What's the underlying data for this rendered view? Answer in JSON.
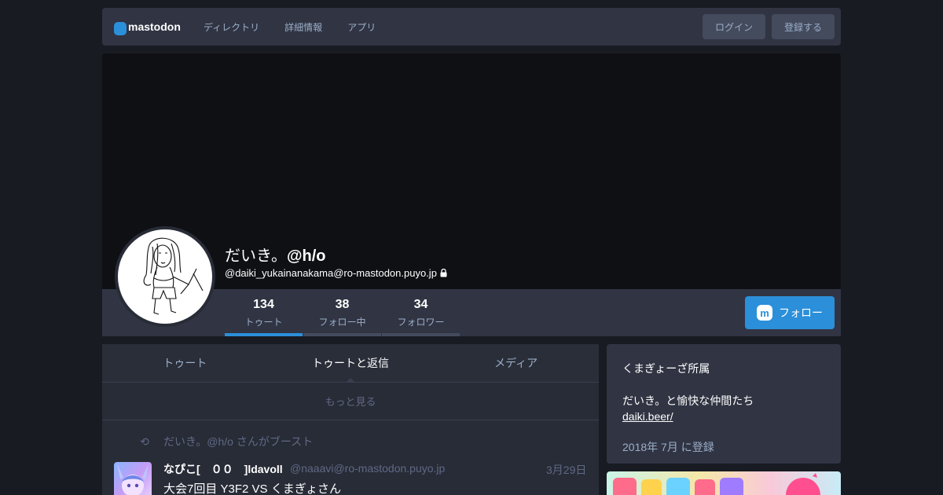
{
  "nav": {
    "logo_text": "mastodon",
    "links": [
      "ディレクトリ",
      "詳細情報",
      "アプリ"
    ],
    "login_label": "ログイン",
    "register_label": "登録する"
  },
  "profile": {
    "display_name": "だいき。",
    "display_name_suffix": "@h/o",
    "acct": "@daiki_yukainanakama@ro-mastodon.puyo.jp",
    "locked": true,
    "counters": [
      {
        "num": "134",
        "label": "トゥート"
      },
      {
        "num": "38",
        "label": "フォロー中"
      },
      {
        "num": "34",
        "label": "フォロワー"
      }
    ],
    "follow_label": "フォロー"
  },
  "tabs": [
    "トゥート",
    "トゥートと返信",
    "メディア"
  ],
  "active_tab": 1,
  "more_label": "もっと見る",
  "status": {
    "boost_text": "だいき。@h/o さんがブースト",
    "name": "なぴこ[　００　]ldavoll",
    "acct": "@naaavi@ro-mastodon.puyo.jp",
    "time": "3月29日",
    "content": "大会7回目 Y3F2 VS くまぎょさん"
  },
  "sidebar": {
    "bio_line1": "くまぎょーざ所属",
    "bio_line2": "だいき。と愉快な仲間たち",
    "bio_link": "daiki.beer/",
    "joined": "2018年 7月 に登録"
  },
  "colors": {
    "accent": "#2b90d9",
    "background": "#191b22",
    "panel": "#313543"
  }
}
